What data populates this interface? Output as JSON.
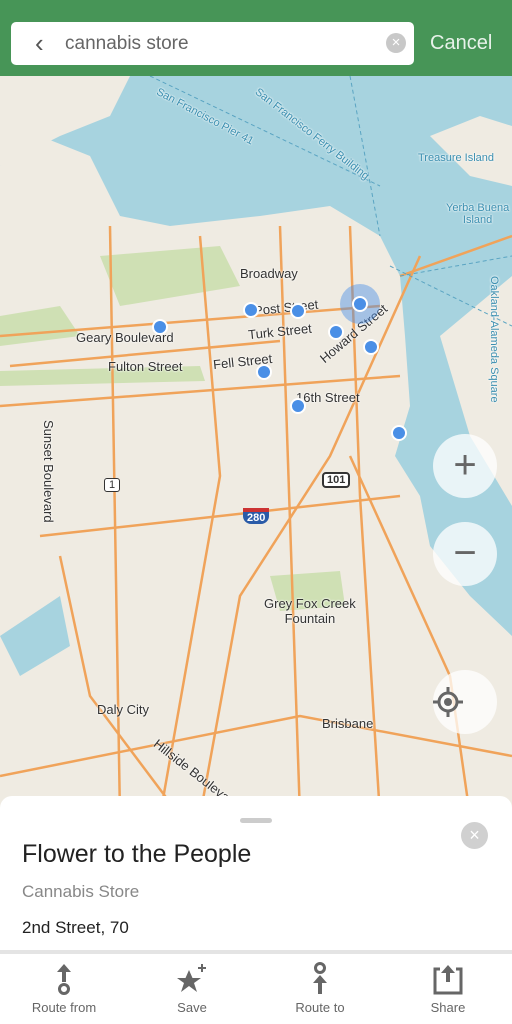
{
  "search": {
    "query": "cannabis store",
    "cancel_label": "Cancel"
  },
  "map": {
    "labels": {
      "broadway": "Broadway",
      "geary": "Geary Boulevard",
      "fulton": "Fulton Street",
      "fell": "Fell Street",
      "post": "Post Street",
      "turk": "Turk Street",
      "howard": "Howard Street",
      "st16": "16th Street",
      "sunset": "Sunset Boulevard",
      "greyfox": "Grey Fox Creek\nFountain",
      "daly": "Daly City",
      "brisbane": "Brisbane",
      "hillside": "Hillside Boulevard",
      "treasure": "Treasure Island",
      "yerba": "Yerba Buena\nIsland",
      "pier41": "San Francisco Pier 41",
      "ferry": "San Francisco Ferry Building",
      "oakland": "Oakland-Alameda Square"
    },
    "shields": {
      "hwy1": "1",
      "us101": "101",
      "i280": "280"
    },
    "colors": {
      "water": "#a7d3df",
      "land": "#efebe2",
      "park": "#cfe0b4",
      "road": "#f0a35a",
      "accent": "#479557",
      "pin": "#4a8fe6"
    }
  },
  "controls": {
    "zoom_in": "+",
    "zoom_out": "−"
  },
  "place": {
    "name": "Flower to the People",
    "category": "Cannabis Store",
    "address": "2nd Street, 70"
  },
  "actions": [
    {
      "label": "Route from",
      "icon": "route-from-icon"
    },
    {
      "label": "Save",
      "icon": "star-plus-icon"
    },
    {
      "label": "Route to",
      "icon": "route-to-icon"
    },
    {
      "label": "Share",
      "icon": "share-icon"
    }
  ]
}
